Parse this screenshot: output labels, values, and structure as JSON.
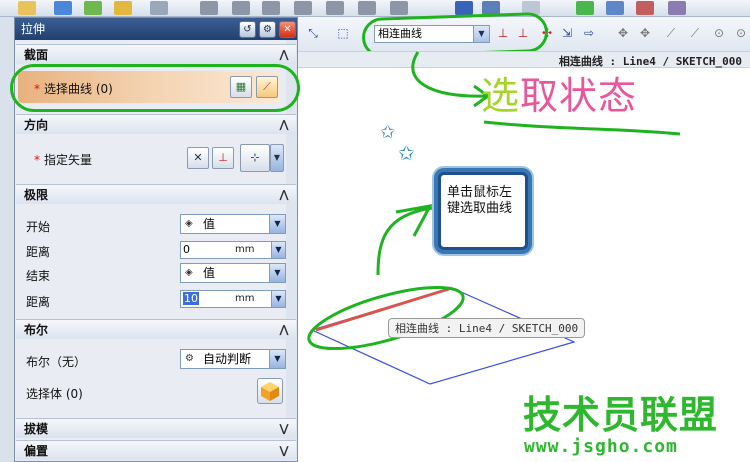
{
  "dialog": {
    "title": "拉伸",
    "sections": {
      "section": {
        "label": "截面",
        "select_curve_label": "选择曲线 (0)"
      },
      "direction": {
        "label": "方向",
        "specify_vector_label": "指定矢量"
      },
      "limits": {
        "label": "极限",
        "start_label": "开始",
        "start_value": "值",
        "start_distance_label": "距离",
        "start_distance_value": "0",
        "end_label": "结束",
        "end_value": "值",
        "end_distance_label": "距离",
        "end_distance_value": "10",
        "unit": "mm"
      },
      "boolean": {
        "label": "布尔",
        "boolean_label": "布尔（无）",
        "boolean_value": "自动判断",
        "select_body_label": "选择体 (0)"
      },
      "draft": {
        "label": "拔模"
      },
      "offset": {
        "label": "偏置"
      }
    }
  },
  "toolbar": {
    "curve_rule_value": "相连曲线"
  },
  "status": {
    "selection_text": "相连曲线 : Line4 / SKETCH_000"
  },
  "canvas": {
    "annotation_title_part1": "选",
    "annotation_title_part2": "取状态",
    "note_text": "单击鼠标左键选取曲线",
    "curve_tooltip": "相连曲线 : Line4 / SKETCH_000"
  },
  "watermark": {
    "site_name": "技术员联盟",
    "url": "www.jsgho.com"
  },
  "colors": {
    "annotation_green": "#1fb31f",
    "title_part1": "#a7d42b",
    "title_part2": "#e8579c",
    "selected_curve": "#d9534f",
    "sketch_plane": "#3b4fe0",
    "dialog_title_bg": "#2a4a7c"
  }
}
